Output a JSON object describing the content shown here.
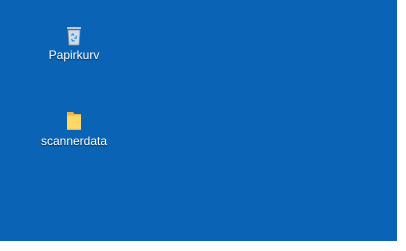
{
  "desktop": {
    "background_color": "#0a63b5",
    "icons": [
      {
        "label": "Papirkurv",
        "icon": "recycle-bin-icon"
      },
      {
        "label": "scannerdata",
        "icon": "folder-icon"
      }
    ]
  }
}
